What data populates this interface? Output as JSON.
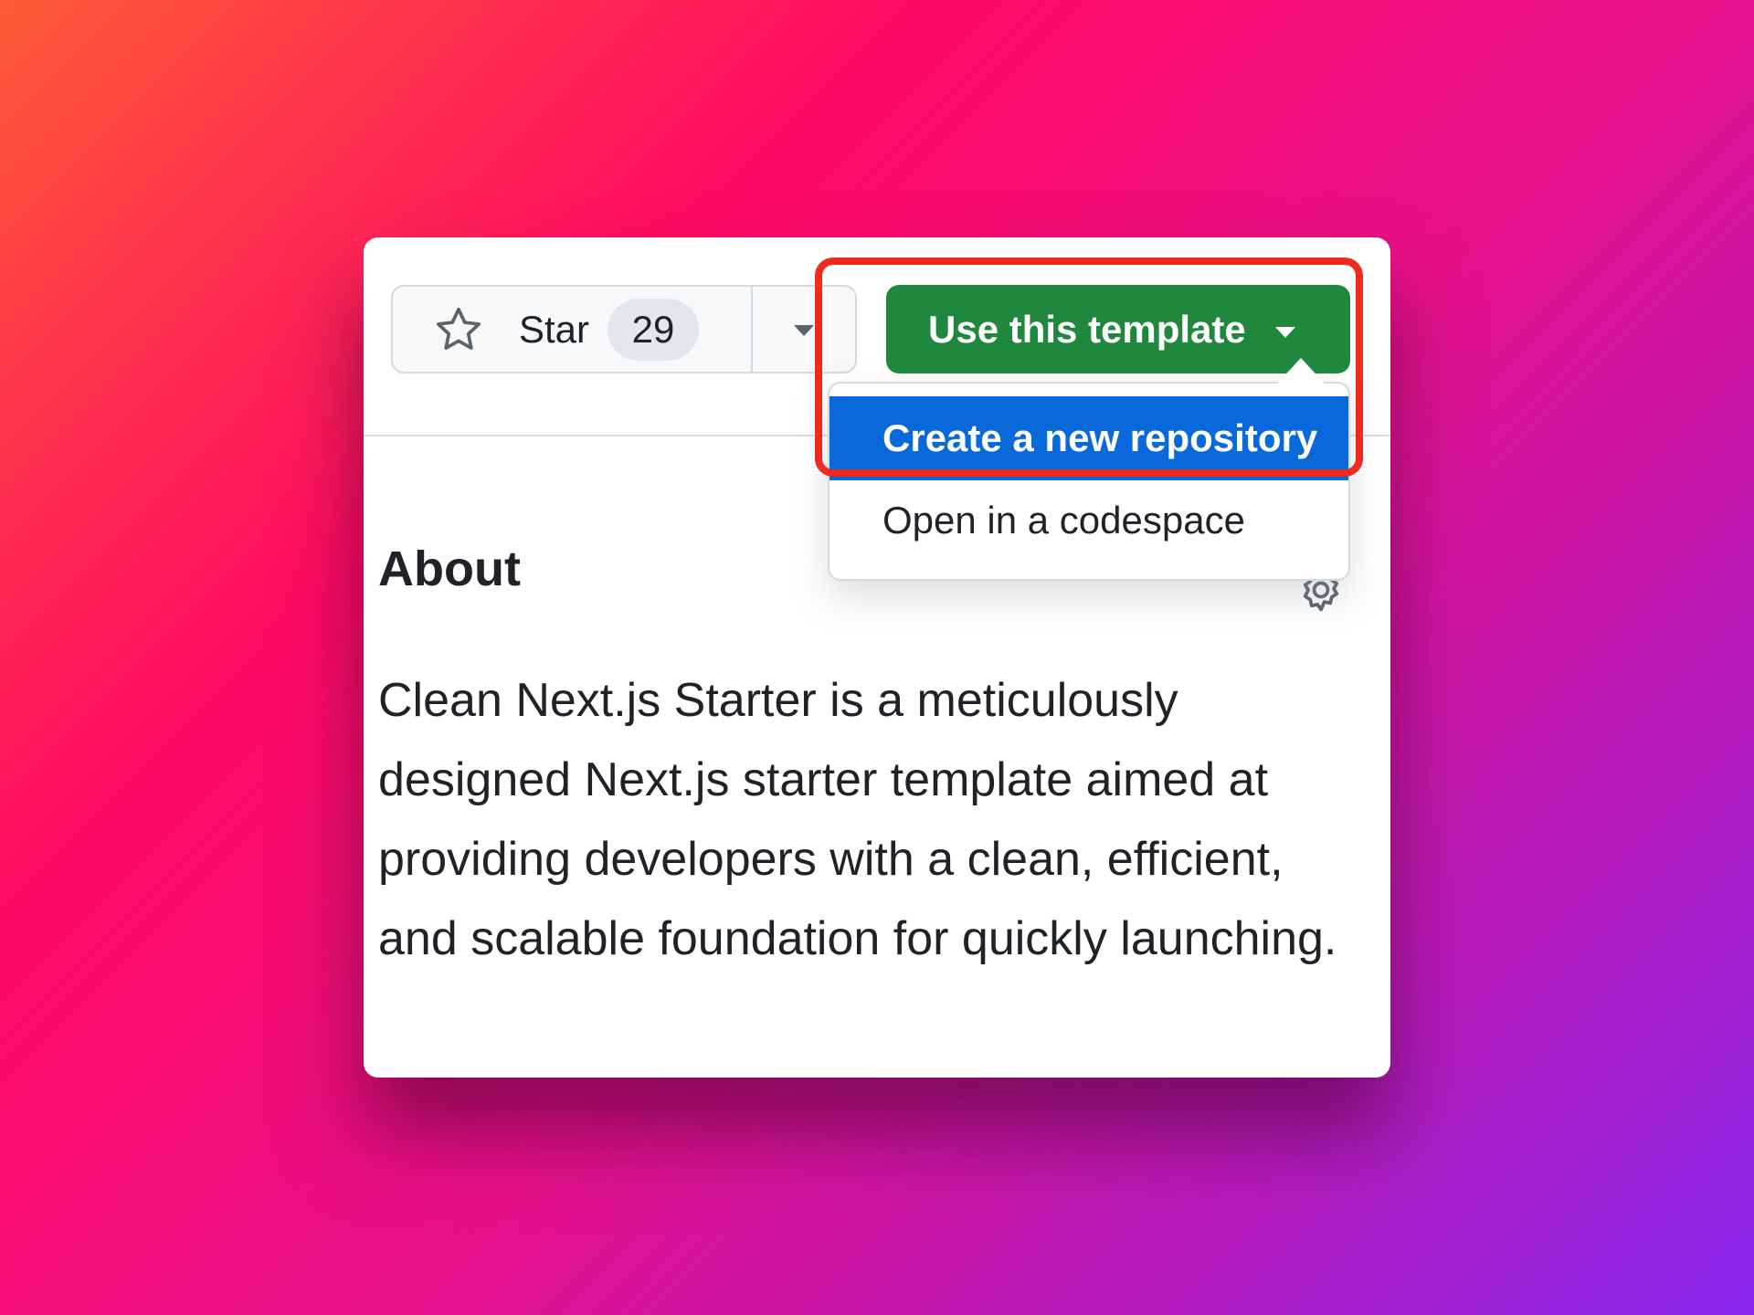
{
  "star": {
    "label": "Star",
    "count": "29",
    "icon": "star-outline-icon",
    "caret_icon": "triangle-down-icon"
  },
  "template_button": {
    "label": "Use this template",
    "caret_icon": "triangle-down-icon",
    "color": "#1f883d"
  },
  "menu": {
    "items": [
      {
        "label": "Create a new repository",
        "state": "highlighted"
      },
      {
        "label": "Open in a codespace"
      }
    ],
    "highlight_color": "#0969da"
  },
  "about": {
    "title": "About",
    "description": "Clean Next.js Starter is a meticulously designed Next.js starter template aimed at providing developers with a clean, efficient, and scalable foundation for quickly launching.",
    "settings_icon": "gear-icon"
  },
  "annotation": {
    "color": "#ee2a1c"
  }
}
